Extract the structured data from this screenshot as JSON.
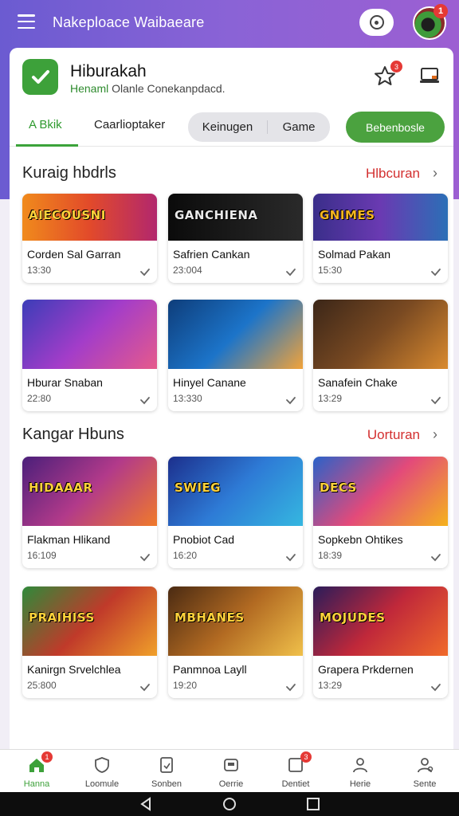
{
  "header": {
    "site_title": "Nakeploace Waibaeare",
    "avatar_badge": "1"
  },
  "app": {
    "name": "Hiburakah",
    "subtitle_highlight": "Henaml",
    "subtitle_rest": "Olanle Conekanpdacd.",
    "fav_badge": "3"
  },
  "tabs": {
    "tab1": "A Bkik",
    "tab2": "Caarlioptaker",
    "seg1": "Keinugen",
    "seg2": "Game",
    "action_button": "Bebenbosle"
  },
  "sections": [
    {
      "title": "Kuraig hbdrls",
      "link": "Hlbcuran",
      "tiles": [
        {
          "banner": "AIECOUSNI",
          "title": "Corden Sal Garran",
          "meta": "13:30",
          "grad": "linear-gradient(90deg,#f08a1c,#e24a2a,#b2276d)",
          "bannerColor": "#ffd23a"
        },
        {
          "banner": "GANCHIENA",
          "title": "Safrien Cankan",
          "meta": "23:004",
          "grad": "linear-gradient(90deg,#0b0b0b,#2a2a2a)",
          "bannerColor": "#e9e9e9"
        },
        {
          "banner": "GNIMES",
          "title": "Solmad Pakan",
          "meta": "15:30",
          "grad": "linear-gradient(90deg,#3a2e8a,#6a3ab2,#2b6fb6)",
          "bannerColor": "#f5b51f"
        }
      ]
    },
    {
      "title": "",
      "link": "",
      "tiles": [
        {
          "banner": "",
          "title": "Hburar Snaban",
          "meta": "22:80",
          "grad": "linear-gradient(135deg,#3b3db8,#a33dc9,#e65a8b)",
          "bannerColor": "#ffe04a"
        },
        {
          "banner": "",
          "title": "Hinyel Canane",
          "meta": "13:330",
          "grad": "linear-gradient(135deg,#0e3d7a,#1c74c9,#f2a33a)",
          "bannerColor": "#ffe04a"
        },
        {
          "banner": "",
          "title": "Sanafein Chake",
          "meta": "13:29",
          "grad": "linear-gradient(135deg,#3b2618,#7a4a22,#d98a2f)",
          "bannerColor": "#ffe04a"
        }
      ]
    },
    {
      "title": "Kangar Hbuns",
      "link": "Uorturan",
      "tiles": [
        {
          "banner": "HIDAAAR",
          "title": "Flakman Hlikand",
          "meta": "16:109",
          "grad": "linear-gradient(135deg,#4a1f7a,#b23a8a,#f07a2a)",
          "bannerColor": "#ffd23a"
        },
        {
          "banner": "SWIEG",
          "title": "Pnobiot Cad",
          "meta": "16:20",
          "grad": "linear-gradient(135deg,#1c2f8c,#2e7bd6,#35b7e0)",
          "bannerColor": "#ffd23a"
        },
        {
          "banner": "DECS",
          "title": "Sopkebn Ohtikes",
          "meta": "18:39",
          "grad": "linear-gradient(135deg,#2a62c9,#e34a7a,#f5b21c)",
          "bannerColor": "#ffd23a"
        }
      ]
    },
    {
      "title": "",
      "link": "",
      "tiles": [
        {
          "banner": "PRAIHISS",
          "title": "Kanirgn Srvelchlea",
          "meta": "25:800",
          "grad": "linear-gradient(135deg,#2e8a3a,#c03a2a,#f0a02a)",
          "bannerColor": "#ffd23a"
        },
        {
          "banner": "MBHANES",
          "title": "Panmnoa Layll",
          "meta": "19:20",
          "grad": "linear-gradient(135deg,#4a2a12,#b26a22,#f0c04a)",
          "bannerColor": "#ffd23a"
        },
        {
          "banner": "MOJUDES",
          "title": "Grapera Prkdernen",
          "meta": "13:29",
          "grad": "linear-gradient(135deg,#2a1c5a,#c0283a,#f06a2a)",
          "bannerColor": "#ffd23a"
        }
      ]
    }
  ],
  "nav": [
    {
      "label": "Hanna",
      "badge": "1",
      "icon": "home-icon",
      "active": true
    },
    {
      "label": "Loomule",
      "badge": "",
      "icon": "shield-icon",
      "active": false
    },
    {
      "label": "Sonben",
      "badge": "",
      "icon": "document-icon",
      "active": false
    },
    {
      "label": "Oerrie",
      "badge": "",
      "icon": "console-icon",
      "active": false
    },
    {
      "label": "Dentiet",
      "badge": "3",
      "icon": "message-icon",
      "active": false
    },
    {
      "label": "Herie",
      "badge": "",
      "icon": "user-icon",
      "active": false
    },
    {
      "label": "Sente",
      "badge": "",
      "icon": "user-settings-icon",
      "active": false
    }
  ],
  "colors": {
    "accent": "#4ba23f",
    "link": "#d32f2f",
    "header": "#7a5ed4"
  }
}
